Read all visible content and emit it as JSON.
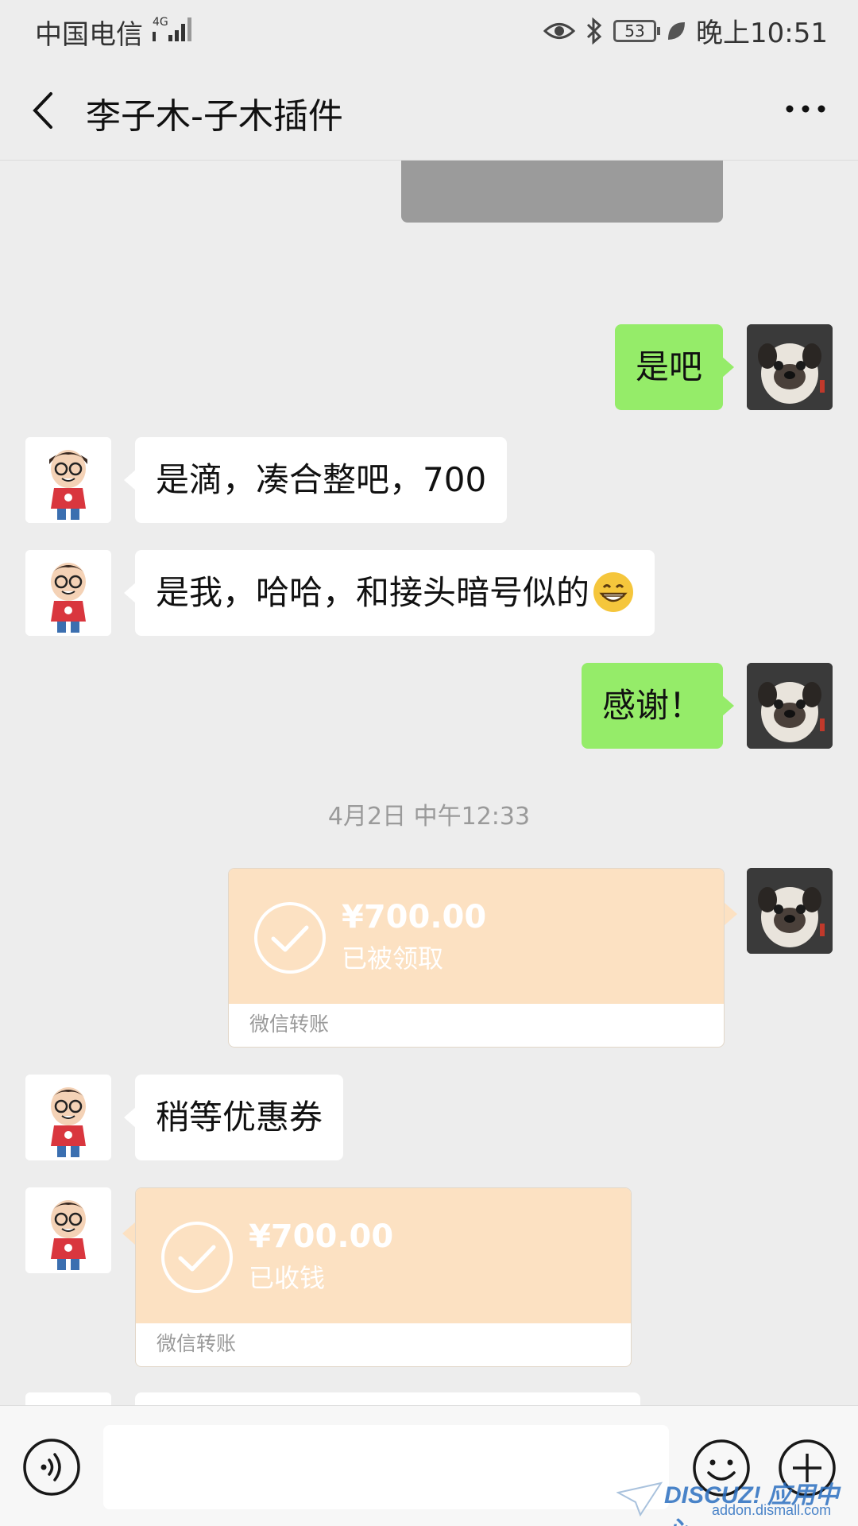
{
  "status_bar": {
    "carrier": "中国电信",
    "network": "4G",
    "battery": "53",
    "time": "晚上10:51"
  },
  "nav": {
    "title": "李子木-子木插件"
  },
  "messages": [
    {
      "side": "self",
      "text": "是吧"
    },
    {
      "side": "other",
      "text": "是滴，凑合整吧，700"
    },
    {
      "side": "other",
      "text": "是我，哈哈，和接头暗号似的"
    },
    {
      "side": "self",
      "text": "感谢！"
    }
  ],
  "timestamp": "4月2日 中午12:33",
  "transfers": [
    {
      "side": "self",
      "amount": "¥700.00",
      "status": "已被领取",
      "label": "微信转账"
    },
    {
      "side": "other",
      "amount": "¥700.00",
      "status": "已收钱",
      "label": "微信转账"
    }
  ],
  "after_transfer_message": {
    "side": "other",
    "text": "稍等优惠券"
  },
  "input": {
    "value": ""
  },
  "watermark": {
    "brand": "DISCUZ! 应用中心",
    "url": "addon.dismall.com"
  },
  "colors": {
    "background": "#ededed",
    "self_bubble": "#95ec69",
    "other_bubble": "#ffffff",
    "transfer_card": "#fce1c2",
    "timestamp_text": "#9a9a9a"
  }
}
